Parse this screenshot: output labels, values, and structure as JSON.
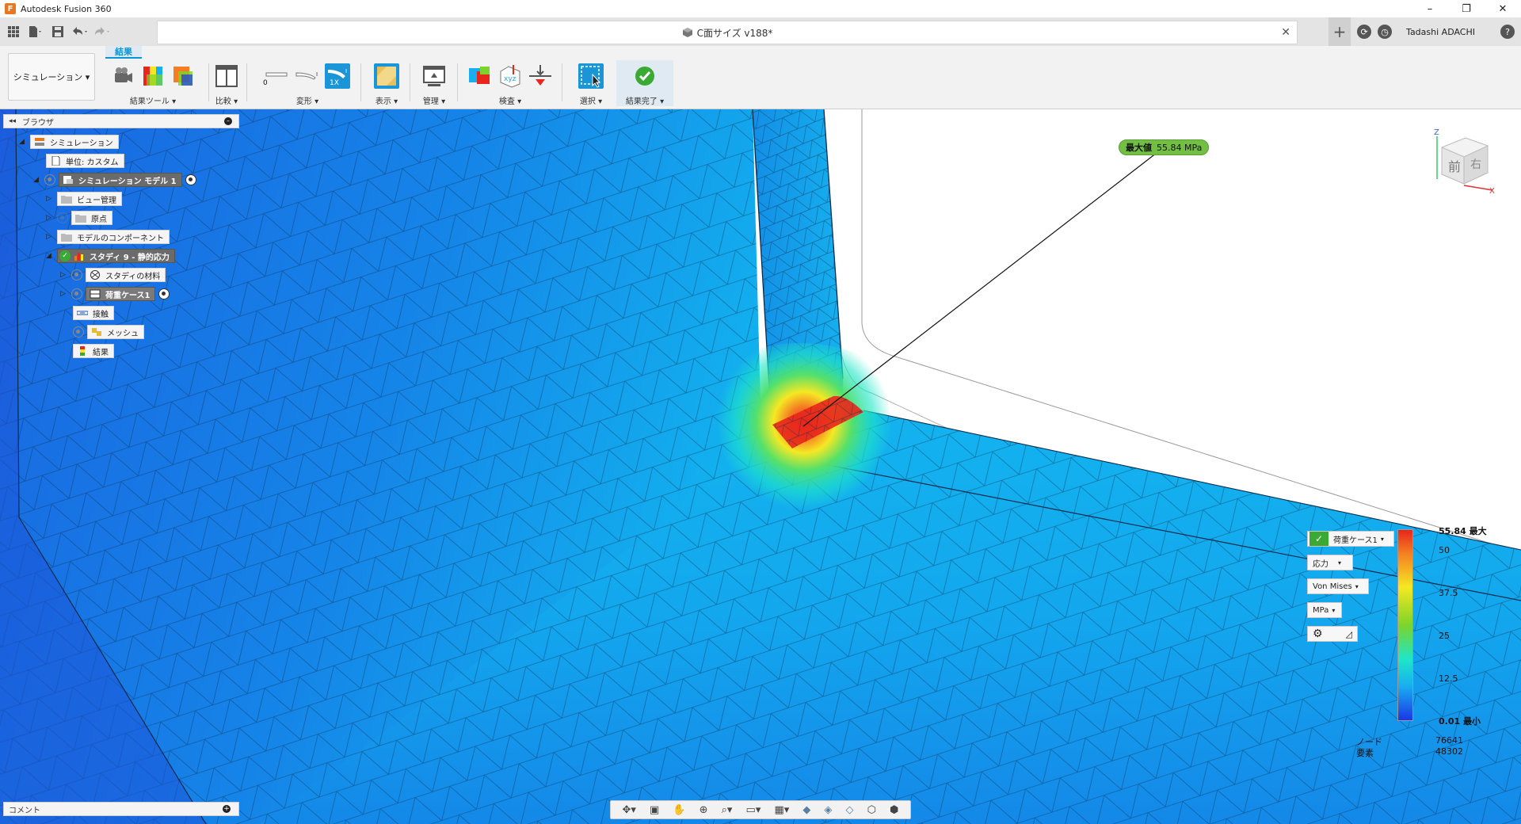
{
  "window": {
    "app_title": "Autodesk Fusion 360",
    "logo_letter": "F",
    "minimize": "–",
    "maximize": "❐",
    "close": "✕"
  },
  "qat": {
    "grid_icon": "grid-icon",
    "file_icon": "file-icon",
    "save_icon": "save-icon",
    "undo_icon": "undo-icon",
    "redo_icon": "redo-icon"
  },
  "document": {
    "title": "C面サイズ v188*",
    "close": "✕",
    "new_tab": "+"
  },
  "user": {
    "name": "Tadashi ADACHI",
    "help": "?"
  },
  "ribbon": {
    "workspace_label": "シミュレーション ▾",
    "active_tab": "結果",
    "groups": [
      {
        "label": "結果ツール ▾"
      },
      {
        "label": "比較 ▾"
      },
      {
        "label": "変形 ▾"
      },
      {
        "label": "表示 ▾"
      },
      {
        "label": "管理 ▾"
      },
      {
        "label": "検査 ▾"
      },
      {
        "label": "選択 ▾"
      },
      {
        "label": "結果完了 ▾"
      }
    ],
    "deform_zero": "0",
    "deform_scale": "1X"
  },
  "browser": {
    "header": "ブラウザ",
    "nodes": [
      {
        "label": "シミュレーション"
      },
      {
        "label": "単位: カスタム"
      },
      {
        "label": "シミュレーション モデル 1"
      },
      {
        "label": "ビュー管理"
      },
      {
        "label": "原点"
      },
      {
        "label": "モデルのコンポーネント"
      },
      {
        "label": "スタディ 9 - 静的応力"
      },
      {
        "label": "スタディの材料"
      },
      {
        "label": "荷重ケース1"
      },
      {
        "label": "接触"
      },
      {
        "label": "メッシュ"
      },
      {
        "label": "結果"
      }
    ]
  },
  "probe": {
    "prefix": "最大値",
    "value": "55.84 MPa"
  },
  "viewcube": {
    "front": "前",
    "right": "右",
    "axis_z": "Z",
    "axis_x": "X"
  },
  "legend": {
    "load_case": "荷重ケース1",
    "result_type": "応力",
    "component": "Von Mises",
    "unit": "MPa",
    "ticks": [
      "55.84 最大",
      "50",
      "37.5",
      "25",
      "12.5",
      "0.01 最小"
    ],
    "colors": [
      "#e8261c",
      "#f5e823",
      "#7cd42a",
      "#19aef0",
      "#1a37e6"
    ],
    "node_label": "ノード",
    "node_value": "76641",
    "element_label": "要素",
    "element_value": "48302"
  },
  "comments": {
    "label": "コメント"
  },
  "navbar": {
    "icons": [
      "orbit-icon",
      "pan-icon",
      "zoom-icon",
      "display-icon",
      "grid-icon",
      "visual-style-icon"
    ]
  }
}
